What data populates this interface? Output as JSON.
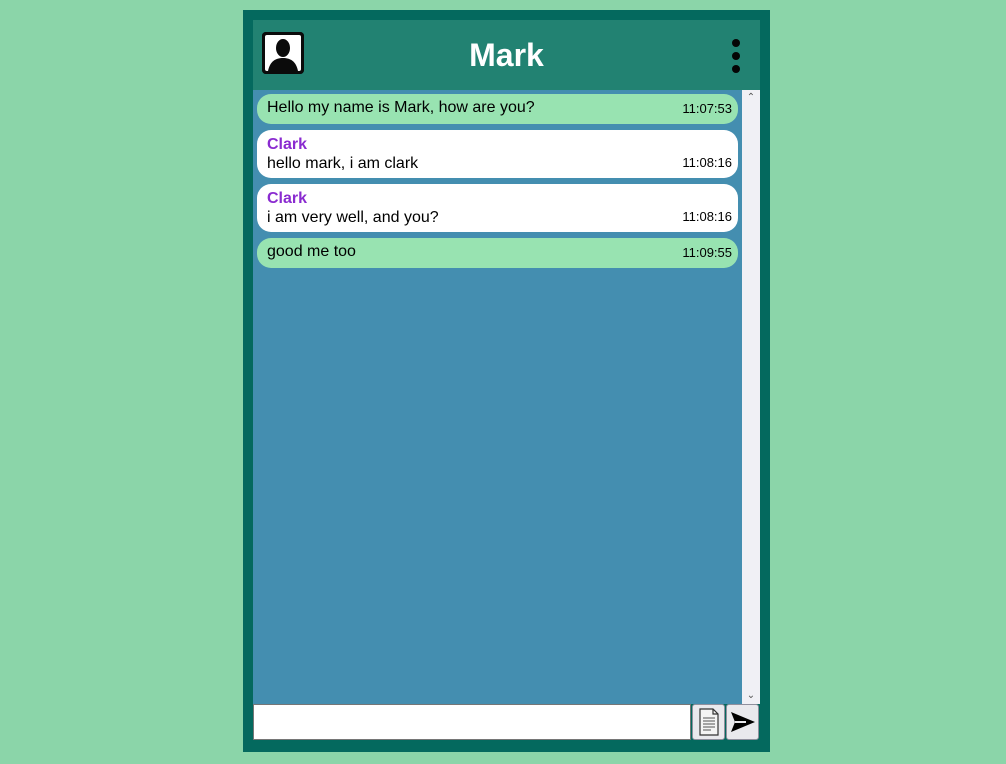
{
  "header": {
    "title": "Mark",
    "avatar_icon": "user-silhouette-icon",
    "menu_icon": "vertical-dots-icon"
  },
  "messages": [
    {
      "type": "mine",
      "text": "Hello my name is Mark, how are you?",
      "time": "11:07:53"
    },
    {
      "type": "theirs",
      "sender": "Clark",
      "text": "hello mark, i am clark",
      "time": "11:08:16"
    },
    {
      "type": "theirs",
      "sender": "Clark",
      "text": "i am very well, and you?",
      "time": "11:08:16"
    },
    {
      "type": "mine",
      "text": "good me too",
      "time": "11:09:55"
    }
  ],
  "composer": {
    "value": "",
    "placeholder": "",
    "attach_icon": "document-attach-icon",
    "send_icon": "send-arrow-icon"
  },
  "colors": {
    "background": "#8bd5a9",
    "frame": "#04695e",
    "header": "#228272",
    "chat_bg": "#448eb0",
    "own_bubble": "#98e3b1",
    "other_bubble": "#ffffff",
    "sender_name": "#8a2bd0"
  }
}
